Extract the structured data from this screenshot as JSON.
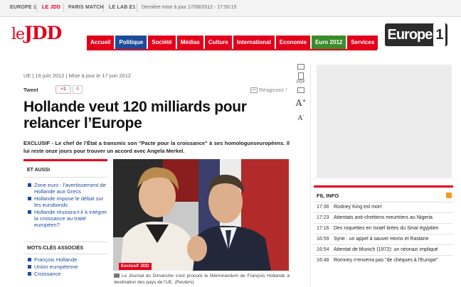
{
  "topbar": {
    "links": [
      "EUROPE 1",
      "LE JDD",
      "PARIS MATCH",
      "LE LAB E1"
    ],
    "last_update": "Dernière mise à jour 17/06/2012 - 17:50:15"
  },
  "header": {
    "logo_le": "le",
    "logo_jdd": "JDD",
    "europe1_logo": "Europe",
    "europe1_num": "1",
    "nav": [
      "Accueil",
      "Politique",
      "Société",
      "Médias",
      "Culture",
      "International",
      "Economie",
      "Euro 2012",
      "Services"
    ]
  },
  "article": {
    "meta": "UE  |  16 juin 2012  |  Mise à jour le 17 juin 2012",
    "tweet": "Tweet",
    "gplus": "+1",
    "gplus_count": "0",
    "react": "Réagissez !",
    "headline": "Hollande veut 120 milliards pour relancer l’Europe",
    "lede": "EXCLUSIF - Le chef de l’État a transmis son \"Pacte pour la croissance\" à ses homologueseuropéens. Il lui reste onze jours pour trouver un accord avec Angela Merkel.",
    "photo_badge": "Exclusif JDD",
    "caption": "Le Journal du Dimanche s’est procuré le Mémorandum de François Hollande à destination des pays de l’UE. (Reuters)"
  },
  "et_aussi": {
    "title": "ET AUSSI",
    "items": [
      "Zone euro : l’avertissement de Hollande aux Grecs",
      "Hollande impose le débat sur les eurobonds",
      "Hollande réussira-t-il à intégrer la croissance au traité européen?"
    ]
  },
  "mots_cles": {
    "title": "MOTS-CLÉS ASSOCIÉS",
    "items": [
      "François Hollande",
      "Union européenne",
      "Croissance"
    ]
  },
  "tools": {
    "pdf": "PDF",
    "a_big": "A",
    "a_plus": "+",
    "a_small": "A",
    "a_minus": "-"
  },
  "fil_info": {
    "title": "FIL INFO",
    "items": [
      {
        "time": "17:36",
        "text": "Rodney King est mort"
      },
      {
        "time": "17:23",
        "text": "Attentats anti-chrétiens meurtriers au Nigeria"
      },
      {
        "time": "17:16",
        "text": "Des roquettes en Israël tirées du Sinaï égyptien"
      },
      {
        "time": "16:59",
        "text": "Syrie : un appel à sauver Homs et Rastane"
      },
      {
        "time": "16:54",
        "text": "Attentat de Munich (1972): un néonazi impliqué"
      },
      {
        "time": "16:48",
        "text": "Romney n'enverra pas \"de chèques à l'Europe\""
      }
    ]
  },
  "colors": {
    "brand_red": "#e3001b",
    "nav_blue": "#1e4c9a",
    "nav_green": "#3a8d2b"
  }
}
